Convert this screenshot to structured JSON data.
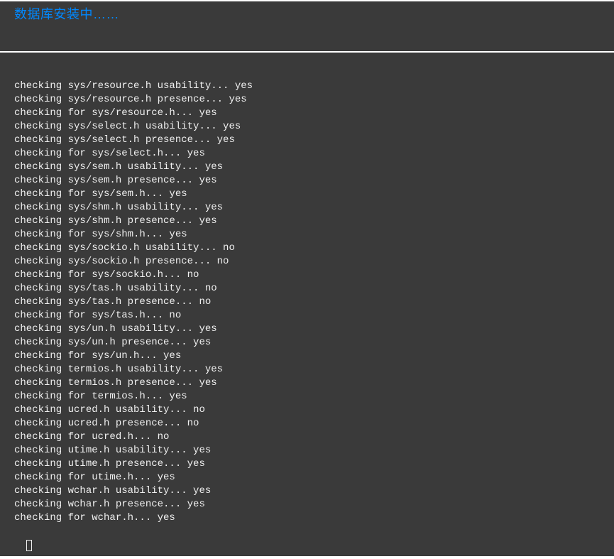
{
  "header": {
    "title": "数据库安装中……"
  },
  "log": {
    "lines": [
      "checking sys/resource.h usability... yes",
      "checking sys/resource.h presence... yes",
      "checking for sys/resource.h... yes",
      "checking sys/select.h usability... yes",
      "checking sys/select.h presence... yes",
      "checking for sys/select.h... yes",
      "checking sys/sem.h usability... yes",
      "checking sys/sem.h presence... yes",
      "checking for sys/sem.h... yes",
      "checking sys/shm.h usability... yes",
      "checking sys/shm.h presence... yes",
      "checking for sys/shm.h... yes",
      "checking sys/sockio.h usability... no",
      "checking sys/sockio.h presence... no",
      "checking for sys/sockio.h... no",
      "checking sys/tas.h usability... no",
      "checking sys/tas.h presence... no",
      "checking for sys/tas.h... no",
      "checking sys/un.h usability... yes",
      "checking sys/un.h presence... yes",
      "checking for sys/un.h... yes",
      "checking termios.h usability... yes",
      "checking termios.h presence... yes",
      "checking for termios.h... yes",
      "checking ucred.h usability... no",
      "checking ucred.h presence... no",
      "checking for ucred.h... no",
      "checking utime.h usability... yes",
      "checking utime.h presence... yes",
      "checking for utime.h... yes",
      "checking wchar.h usability... yes",
      "checking wchar.h presence... yes",
      "checking for wchar.h... yes"
    ]
  }
}
